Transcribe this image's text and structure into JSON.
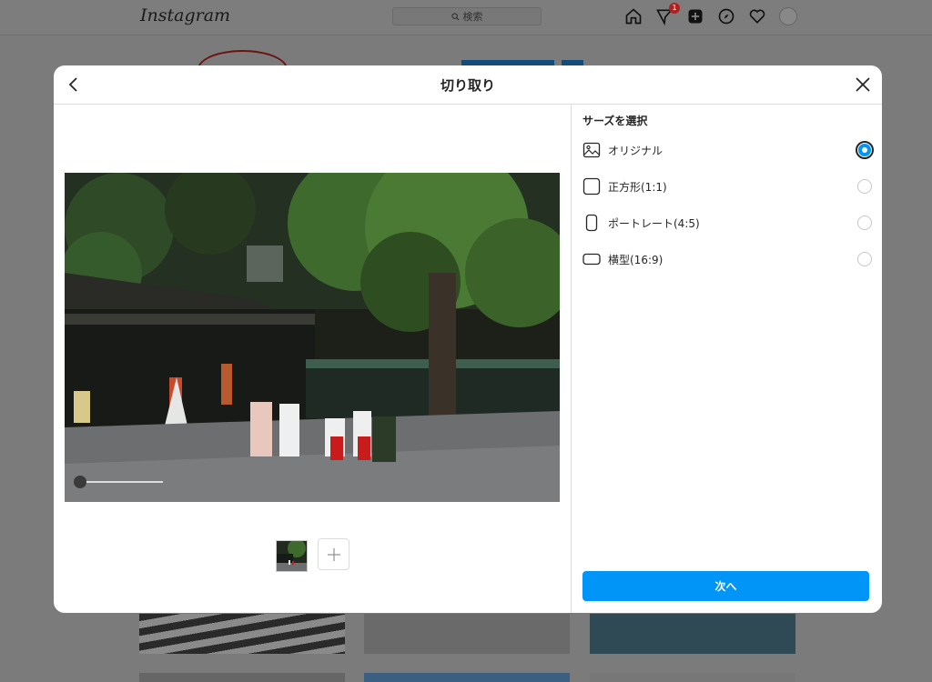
{
  "app": {
    "logo_text": "Instagram",
    "search_placeholder": "検索",
    "notification_count": "1"
  },
  "modal": {
    "title": "切り取り",
    "size_heading": "サーズを選択",
    "options": [
      {
        "label": "オリジナル",
        "icon": "image-icon",
        "selected": true
      },
      {
        "label": "正方形(1:1)",
        "icon": "square-icon",
        "selected": false
      },
      {
        "label": "ポートレート(4:5)",
        "icon": "portrait-icon",
        "selected": false
      },
      {
        "label": "横型(16:9)",
        "icon": "landscape-icon",
        "selected": false
      }
    ],
    "next_label": "次へ"
  },
  "colors": {
    "accent": "#0095f6",
    "text": "#262626",
    "divider": "#dbdbdb"
  }
}
